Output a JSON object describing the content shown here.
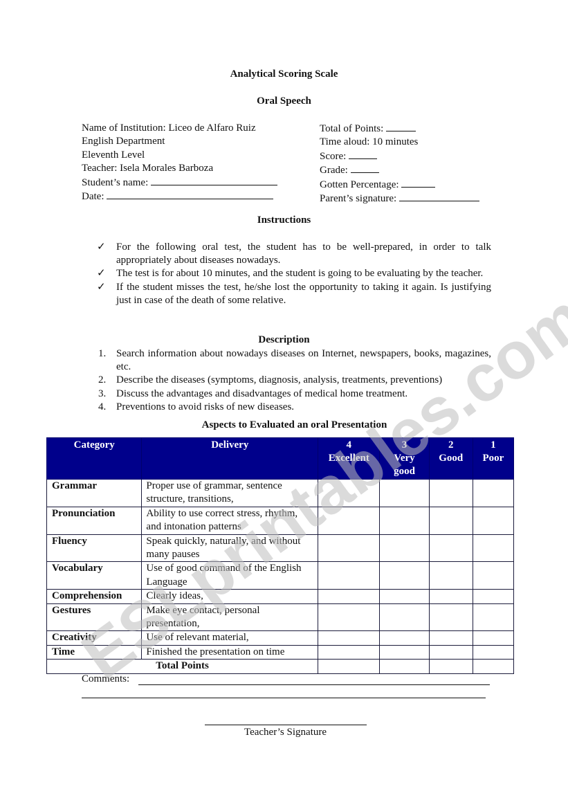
{
  "document": {
    "title": "Analytical Scoring Scale",
    "subtitle": "Oral Speech",
    "info_left": [
      {
        "label": "Name of Institution:  Liceo de Alfaro Ruiz",
        "blank": false
      },
      {
        "label": "English Department",
        "blank": false
      },
      {
        "label": "Eleventh Level",
        "blank": false
      },
      {
        "label": "Teacher:  Isela Morales Barboza",
        "blank": false
      },
      {
        "label": "Student’s name:",
        "blank": true
      },
      {
        "label": "Date:",
        "blank": true
      }
    ],
    "info_right": [
      {
        "label": "Total of Points:",
        "blank": true
      },
      {
        "label": "Time aloud:  10 minutes",
        "blank": false
      },
      {
        "label": "Score:",
        "blank": true
      },
      {
        "label": "Grade:",
        "blank": true
      },
      {
        "label": "Gotten Percentage:",
        "blank": true
      },
      {
        "label": "Parent’s signature:",
        "blank": true
      }
    ],
    "instructions": {
      "heading": "Instructions",
      "bullet_icon": "✓",
      "items": [
        "For the following oral test, the student has to be well-prepared, in order to talk appropriately about diseases nowadays.",
        "The test is for about 10 minutes, and the student is going to be evaluating by the teacher.",
        "If the student misses the test, he/she lost the opportunity to taking it again.  Is justifying just in case of the death of some relative."
      ]
    },
    "description": {
      "heading": "Description",
      "items": [
        {
          "num": "1.",
          "text": "Search information about nowadays diseases on Internet, newspapers, books, magazines, etc."
        },
        {
          "num": "2.",
          "text": "Describe the diseases (symptoms, diagnosis, analysis, treatments, preventions)"
        },
        {
          "num": "3.",
          "text": "Discuss the advantages and disadvantages of medical home treatment."
        },
        {
          "num": "4.",
          "text": "Preventions to avoid risks of new diseases."
        }
      ]
    },
    "rubric": {
      "heading": "Aspects to Evaluated an oral Presentation",
      "header_color": "#00008b",
      "columns": {
        "category": "Category",
        "delivery": "Delivery",
        "score4": {
          "num": "4",
          "label": "Excellent"
        },
        "score3": {
          "num": "3",
          "label": "Very good"
        },
        "score2": {
          "num": "2",
          "label": "Good"
        },
        "score1": {
          "num": "1",
          "label": "Poor"
        }
      },
      "rows": [
        {
          "category": "Grammar",
          "delivery": "Proper use of grammar, sentence structure, transitions,"
        },
        {
          "category": "Pronunciation",
          "delivery": "Ability to use correct stress, rhythm, and intonation patterns"
        },
        {
          "category": "Fluency",
          "delivery": "Speak quickly, naturally, and without many pauses"
        },
        {
          "category": "Vocabulary",
          "delivery": "Use of good command of the English Language"
        },
        {
          "category": "Comprehension",
          "delivery": "Clearly ideas,"
        },
        {
          "category": "Gestures",
          "delivery": "Make eye contact, personal presentation,"
        },
        {
          "category": "Creativity",
          "delivery": "Use of relevant material,"
        },
        {
          "category": "Time",
          "delivery": "Finished the presentation on time"
        }
      ],
      "total_label": "Total Points"
    },
    "comments_label": "Comments:",
    "signature_label": "Teacher’s Signature",
    "watermark": "ESLprintables.com"
  }
}
